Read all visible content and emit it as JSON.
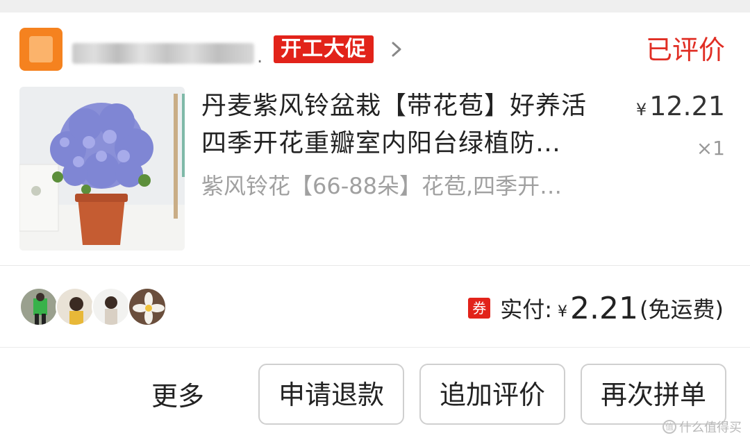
{
  "shop": {
    "promo_tag": "开工大促",
    "review_status": "已评价",
    "shop_dot": "."
  },
  "product": {
    "title_line1": "丹麦紫风铃盆栽【带花苞】好养活",
    "title_line2": "四季开花重瓣室内阳台绿植防…",
    "spec": "紫风铃花【66-88朵】花苞,四季开…",
    "price_symbol": "¥",
    "price": "12.21",
    "quantity": "×1"
  },
  "payment": {
    "coupon_badge": "券",
    "label": "实付:",
    "currency": "¥",
    "amount": "2.21",
    "shipping_note": "(免运费)"
  },
  "actions": {
    "more": "更多",
    "refund": "申请退款",
    "add_review": "追加评价",
    "reorder": "再次拼单"
  },
  "watermark": {
    "text": "什么值得买",
    "icon": "值"
  },
  "colors": {
    "accent_red": "#e02e24",
    "shop_orange": "#f5821f"
  },
  "icons": {
    "shop_logo": "shop-logo-icon",
    "chevron": "chevron-right-icon"
  }
}
